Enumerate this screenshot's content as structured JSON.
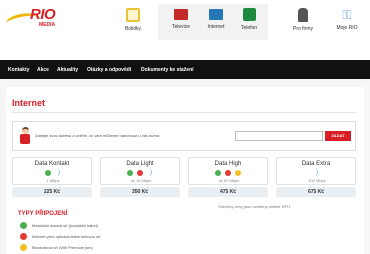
{
  "brand": {
    "logo_main": "RIO",
    "logo_sub": "MEDIA",
    "accent": "#d81f26"
  },
  "top_nav": [
    {
      "label": "Bolidky",
      "icon": "car-icon"
    },
    {
      "label": "Televize",
      "icon": "tv-icon"
    },
    {
      "label": "Internet",
      "icon": "laptop-icon"
    },
    {
      "label": "Telefon",
      "icon": "phone-icon"
    },
    {
      "label": "Pro firmy",
      "icon": "person-icon"
    },
    {
      "label": "Moje RIO",
      "icon": "key-icon"
    }
  ],
  "menu": [
    "Kontakty",
    "Akce",
    "Aktuality",
    "Otázky a odpovědi",
    "Dokumenty ke stažení"
  ],
  "page_title": "Internet",
  "address_check": {
    "text": "Zadejte svou adresu a ověřte, co vám můžeme nabídnout u vás doma.",
    "placeholder": "",
    "button": "ZADAT"
  },
  "tariffs": [
    {
      "name": "Data Kontakt",
      "speed": "1 Mbps",
      "price": "225 Kč"
    },
    {
      "name": "Data Light",
      "speed": "až 10 Mbps",
      "price": "350 Kč"
    },
    {
      "name": "Data High",
      "speed": "až 60 Mbps",
      "price": "475 Kč"
    },
    {
      "name": "Data Extra",
      "speed": "100 Mbps",
      "price": "675 Kč"
    }
  ],
  "vat_note": "Všechny ceny jsou uvedeny včetně DPH.",
  "connection_types": {
    "title": "TYPY PŘIPOJENÍ",
    "items": [
      {
        "label": "Metalická datová síť (koaxiální kabel)",
        "color": "#4caf50"
      },
      {
        "label": "Internet přes optickou/ethernetovou síť",
        "color": "#e53935"
      },
      {
        "label": "Bezdrátová síť (Wifi Premium jsm)",
        "color": "#f4c020"
      }
    ]
  }
}
